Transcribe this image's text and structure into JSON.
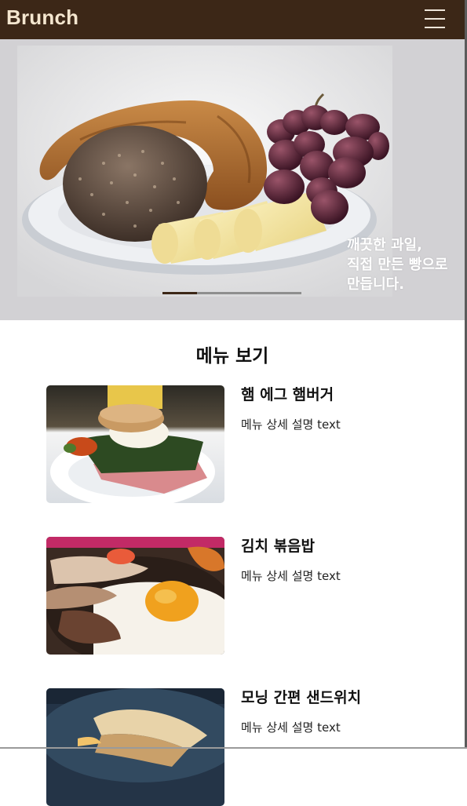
{
  "header": {
    "logo": "Brunch",
    "menu_icon": "hamburger-menu-icon"
  },
  "hero": {
    "caption_line1": "깨끗한 과일,",
    "caption_line2": "직접 만든 빵으로",
    "caption_line3": "만듭니다.",
    "slide_progress": 0.25,
    "accent_color": "#3c2717"
  },
  "menu_section": {
    "title": "메뉴 보기",
    "items": [
      {
        "name": "햄 에그 햄버거",
        "description": "메뉴 상세 설명 text"
      },
      {
        "name": "김치 볶음밥",
        "description": "메뉴 상세 설명 text"
      },
      {
        "name": "모닝 간편 샌드위치",
        "description": "메뉴 상세 설명 text"
      }
    ]
  }
}
